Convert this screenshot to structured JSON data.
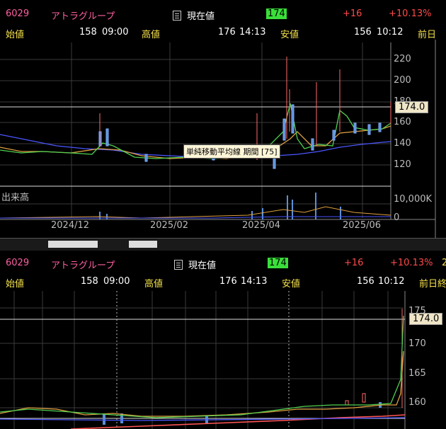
{
  "top": {
    "code": "6029",
    "name": "アトラグループ",
    "current_label": "現在値",
    "current_value": "174",
    "change": "+16",
    "change_pct": "+10.13%",
    "open_label": "始値",
    "open_value": "158",
    "open_time": "09:00",
    "high_label": "高値",
    "high_value": "176",
    "high_time": "14:13",
    "low_label": "安値",
    "low_value": "156",
    "low_time": "10:12",
    "prev_label": "前日",
    "price_tag": "174.0",
    "tooltip": "単純移動平均線 期間 [75]",
    "volume_label": "出来高",
    "volume_axis": "10,000K",
    "volume_zero": "0",
    "y_ticks": [
      "220",
      "200",
      "180",
      "160",
      "140",
      "120"
    ],
    "x_ticks": [
      "2024/12",
      "2025/02",
      "2025/04",
      "2025/06"
    ]
  },
  "bottom": {
    "code": "6029",
    "name": "アトラグループ",
    "current_label": "現在値",
    "current_value": "174",
    "change": "+16",
    "change_pct": "+10.13%",
    "extra": "2",
    "open_label": "始値",
    "open_value": "158",
    "open_time": "09:00",
    "high_label": "高値",
    "high_value": "176",
    "high_time": "14:13",
    "low_label": "安値",
    "low_value": "156",
    "low_time": "10:12",
    "prev_label": "前日終",
    "price_tag": "174.0",
    "y_ticks": [
      "175",
      "170",
      "165",
      "160"
    ]
  },
  "colors": {
    "accent_pink": "#ff5fa0",
    "up": "#ff4a4a",
    "price_box": "#3adf3a",
    "label_yellow": "#f4e04a"
  }
}
